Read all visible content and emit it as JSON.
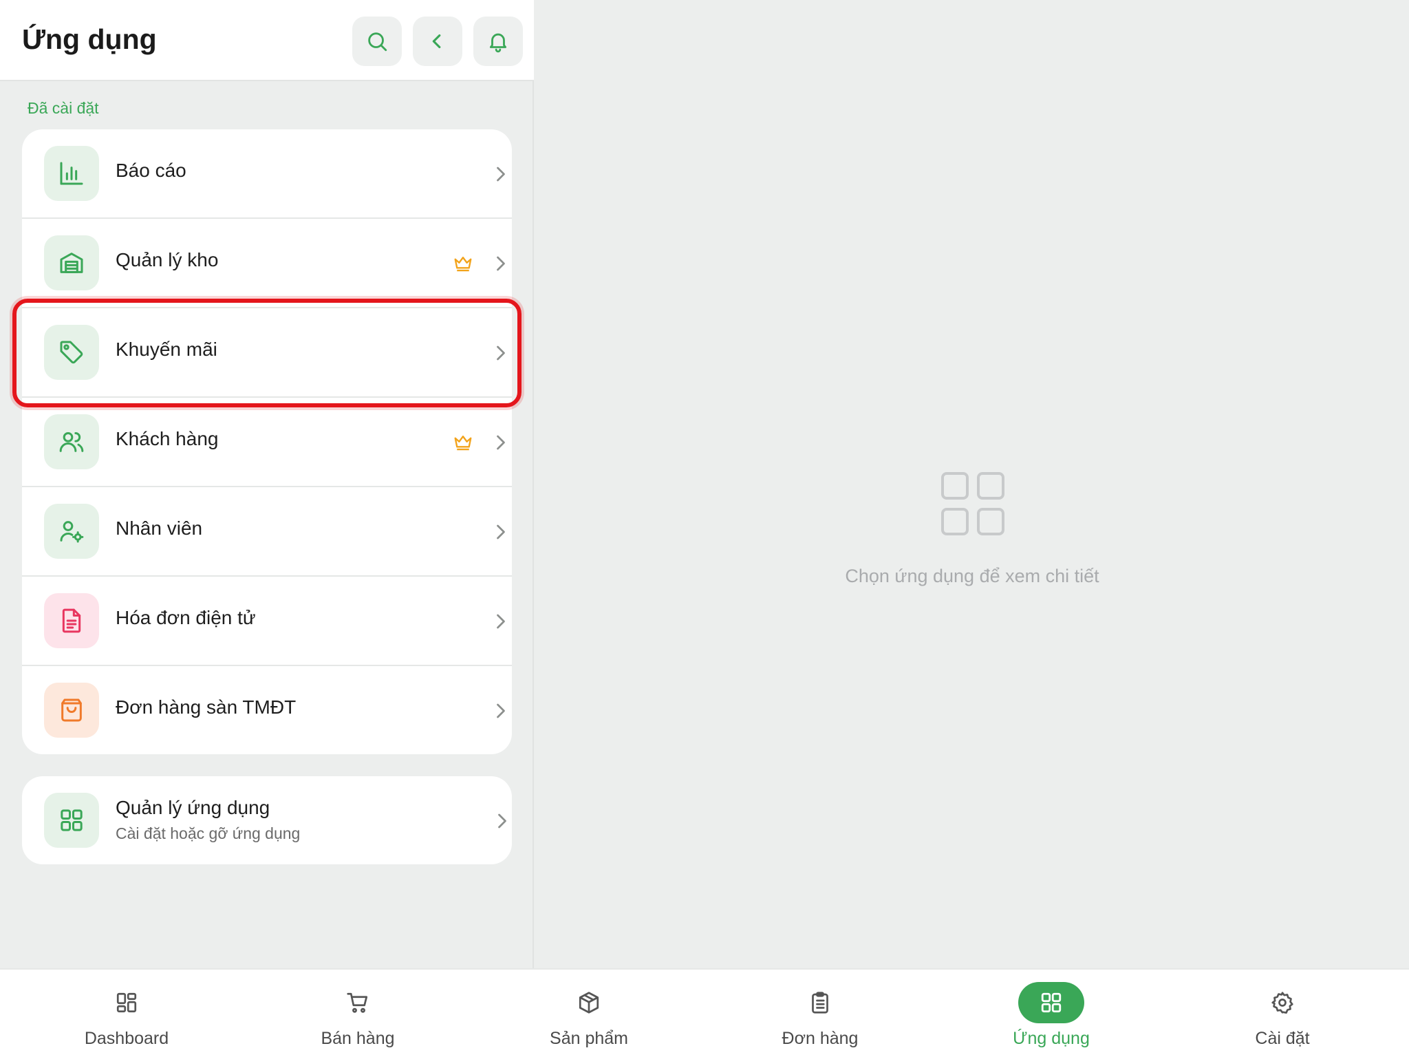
{
  "header": {
    "title": "Ứng dụng"
  },
  "installed": {
    "section_label": "Đã cài đặt",
    "items": [
      {
        "label": "Báo cáo",
        "icon": "bar-chart-icon",
        "premium": false
      },
      {
        "label": "Quản lý kho",
        "icon": "warehouse-icon",
        "premium": true
      },
      {
        "label": "Khuyến mãi",
        "icon": "tag-icon",
        "premium": false,
        "highlighted": true
      },
      {
        "label": "Khách hàng",
        "icon": "users-icon",
        "premium": true
      },
      {
        "label": "Nhân viên",
        "icon": "user-gear-icon",
        "premium": false
      },
      {
        "label": "Hóa đơn điện tử",
        "icon": "document-icon",
        "premium": false
      },
      {
        "label": "Đơn hàng sàn TMĐT",
        "icon": "shopping-bag-icon",
        "premium": false
      }
    ]
  },
  "manage_apps": {
    "title": "Quản lý ứng dụng",
    "subtitle": "Cài đặt hoặc gỡ ứng dụng"
  },
  "empty_state": {
    "text": "Chọn ứng dụng để xem chi tiết"
  },
  "bottom_nav": {
    "items": [
      {
        "label": "Dashboard",
        "icon": "dashboard-icon",
        "active": false
      },
      {
        "label": "Bán hàng",
        "icon": "cart-icon",
        "active": false
      },
      {
        "label": "Sản phẩm",
        "icon": "box-icon",
        "active": false
      },
      {
        "label": "Đơn hàng",
        "icon": "clipboard-icon",
        "active": false
      },
      {
        "label": "Ứng dụng",
        "icon": "apps-grid-icon",
        "active": true
      },
      {
        "label": "Cài đặt",
        "icon": "gear-icon",
        "active": false
      }
    ]
  },
  "colors": {
    "accent": "#3aa757",
    "highlight": "#e4161c",
    "premium": "#f2a31b"
  }
}
